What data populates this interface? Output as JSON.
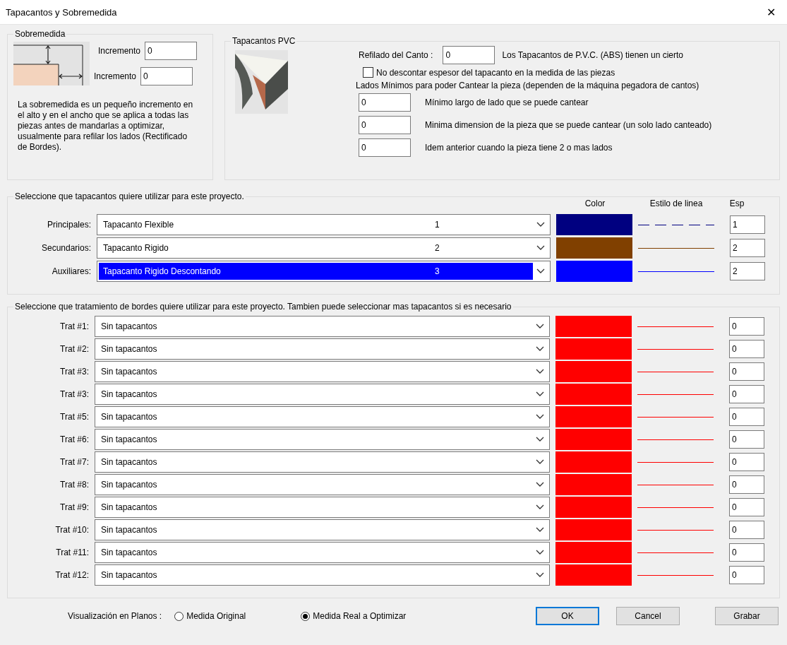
{
  "window": {
    "title": "Tapacantos y Sobremedida",
    "close": "✕"
  },
  "sobremedida": {
    "title": "Sobremedida",
    "fields": [
      {
        "label": "Incremento",
        "value": "0"
      },
      {
        "label": "Incremento",
        "value": "0"
      }
    ],
    "description": "La sobremedida es un pequeño incremento en el alto y en el ancho que se aplica a todas las piezas antes de mandarlas a optimizar, usualmente para refilar los lados (Rectificado de Bordes)."
  },
  "pvc": {
    "title": "Tapacantos PVC",
    "refilado": {
      "label": "Refilado del Canto :",
      "value": "0",
      "note": "Los Tapacantos de P.V.C. (ABS) tienen un cierto"
    },
    "checkbox": {
      "label": "No descontar espesor del tapacanto en la medida de las piezas",
      "checked": false
    },
    "minimos_title": "Lados Mínimos para poder Cantear la pieza (dependen de la máquina pegadora de cantos)",
    "minimos": [
      {
        "value": "0",
        "label": "Mínimo largo de lado que se puede cantear"
      },
      {
        "value": "0",
        "label": "Minima dimension de la pieza  que se puede cantear (un solo lado canteado)"
      },
      {
        "value": "0",
        "label": "Idem anterior cuando la pieza tiene 2 o mas lados"
      }
    ]
  },
  "tapacantos": {
    "title": "Seleccione que tapacantos quiere utilizar para este proyecto.",
    "columns": [
      "Color",
      "Estilo de linea",
      "Esp"
    ],
    "rows": [
      {
        "label": "Principales:",
        "value": "Tapacanto Flexible",
        "code": "1",
        "selected": false,
        "color": "#000080",
        "kind": "dashed",
        "esp": "1"
      },
      {
        "label": "Secundarios:",
        "value": "Tapacanto Rigido",
        "code": "2",
        "selected": false,
        "color": "#804000",
        "kind": "solid",
        "esp": "2"
      },
      {
        "label": "Auxiliares:",
        "value": "Tapacanto Rigido Descontando",
        "code": "3",
        "selected": true,
        "color": "#0000ff",
        "kind": "solid",
        "esp": "2"
      }
    ]
  },
  "tratamientos": {
    "title": "Seleccione que tratamiento de bordes quiere utilizar para este proyecto. Tambien puede seleccionar mas tapacantos si es necesario",
    "rows": [
      {
        "label": "Trat #1:",
        "value": "Sin tapacantos",
        "color": "#ff0000",
        "esp": "0"
      },
      {
        "label": "Trat #2:",
        "value": "Sin tapacantos",
        "color": "#ff0000",
        "esp": "0"
      },
      {
        "label": "Trat #3:",
        "value": "Sin tapacantos",
        "color": "#ff0000",
        "esp": "0"
      },
      {
        "label": "Trat #3:",
        "value": "Sin tapacantos",
        "color": "#ff0000",
        "esp": "0"
      },
      {
        "label": "Trat #5:",
        "value": "Sin tapacantos",
        "color": "#ff0000",
        "esp": "0"
      },
      {
        "label": "Trat #6:",
        "value": "Sin tapacantos",
        "color": "#ff0000",
        "esp": "0"
      },
      {
        "label": "Trat #7:",
        "value": "Sin tapacantos",
        "color": "#ff0000",
        "esp": "0"
      },
      {
        "label": "Trat #8:",
        "value": "Sin tapacantos",
        "color": "#ff0000",
        "esp": "0"
      },
      {
        "label": "Trat #9:",
        "value": "Sin tapacantos",
        "color": "#ff0000",
        "esp": "0"
      },
      {
        "label": "Trat #10:",
        "value": "Sin tapacantos",
        "color": "#ff0000",
        "esp": "0"
      },
      {
        "label": "Trat #11:",
        "value": "Sin tapacantos",
        "color": "#ff0000",
        "esp": "0"
      },
      {
        "label": "Trat #12:",
        "value": "Sin tapacantos",
        "color": "#ff0000",
        "esp": "0"
      }
    ]
  },
  "visualizacion": {
    "label": "Visualización en Planos :",
    "options": [
      {
        "label": "Medida Original",
        "selected": false
      },
      {
        "label": "Medida Real a Optimizar",
        "selected": true
      }
    ]
  },
  "buttons": [
    {
      "label": "OK",
      "default": true
    },
    {
      "label": "Cancel",
      "default": false
    },
    {
      "label": "Grabar",
      "default": false
    }
  ]
}
